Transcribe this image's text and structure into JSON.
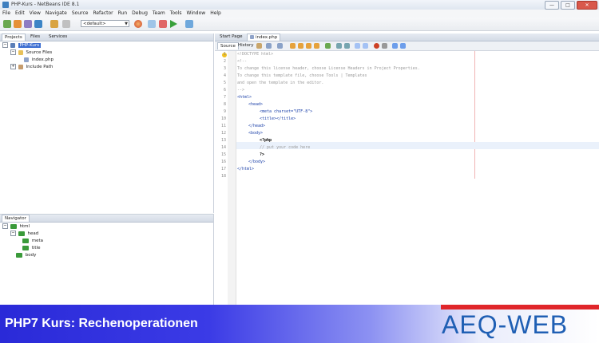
{
  "window": {
    "title": "PHP-Kurs - NetBeans IDE 8.1",
    "controls": [
      "—",
      "□",
      "✕"
    ]
  },
  "menu": [
    "File",
    "Edit",
    "View",
    "Navigate",
    "Source",
    "Refactor",
    "Run",
    "Debug",
    "Team",
    "Tools",
    "Window",
    "Help"
  ],
  "toolbar": {
    "config_value": "<default>",
    "icons": [
      "new-file-icon",
      "new-project-icon",
      "open-project-icon",
      "save-all-icon",
      "undo-icon",
      "redo-icon",
      "browser-icon",
      "clean-build-icon",
      "build-icon",
      "run-icon",
      "debug-icon"
    ]
  },
  "projects_panel": {
    "tabs": [
      "Projects",
      "Files",
      "Services"
    ],
    "tree": [
      {
        "label": "PHP-Kurs",
        "level": 0,
        "icon": "php-project-icon",
        "selected": true
      },
      {
        "label": "Source Files",
        "level": 1,
        "icon": "folder-icon"
      },
      {
        "label": "index.php",
        "level": 2,
        "icon": "php-file-icon"
      },
      {
        "label": "Include Path",
        "level": 1,
        "icon": "library-icon"
      }
    ]
  },
  "navigator_panel": {
    "title": "Navigator",
    "tree": [
      {
        "label": "html",
        "level": 0
      },
      {
        "label": "head",
        "level": 1
      },
      {
        "label": "meta",
        "level": 2
      },
      {
        "label": "title",
        "level": 2
      },
      {
        "label": "body",
        "level": 1
      }
    ]
  },
  "editor": {
    "tabs": [
      "Start Page",
      "index.php"
    ],
    "active_tab": "index.php",
    "mode_tabs": [
      "Source",
      "History"
    ],
    "active_mode": "Source",
    "lines": [
      {
        "n": "1",
        "text": "<!DOCTYPE html>",
        "indent": 0,
        "kind": "doctype"
      },
      {
        "n": "2",
        "text": "<!--",
        "indent": 0,
        "kind": "comment"
      },
      {
        "n": "3",
        "text": "To change this license header, choose License Headers in Project Properties.",
        "indent": 0,
        "kind": "comment"
      },
      {
        "n": "4",
        "text": "To change this template file, choose Tools | Templates",
        "indent": 0,
        "kind": "comment"
      },
      {
        "n": "5",
        "text": "and open the template in the editor.",
        "indent": 0,
        "kind": "comment"
      },
      {
        "n": "6",
        "text": "-->",
        "indent": 0,
        "kind": "comment"
      },
      {
        "n": "7",
        "text": "<html>",
        "indent": 0,
        "kind": "tag"
      },
      {
        "n": "8",
        "text": "<head>",
        "indent": 1,
        "kind": "tag"
      },
      {
        "n": "9",
        "text": "<meta charset=\"UTF-8\">",
        "indent": 2,
        "kind": "tag"
      },
      {
        "n": "10",
        "text": "<title></title>",
        "indent": 2,
        "kind": "tag"
      },
      {
        "n": "11",
        "text": "</head>",
        "indent": 1,
        "kind": "tag"
      },
      {
        "n": "12",
        "text": "<body>",
        "indent": 1,
        "kind": "tag"
      },
      {
        "n": "13",
        "text": "<?php",
        "indent": 2,
        "kind": "php"
      },
      {
        "n": "14",
        "text": "// put your code here",
        "indent": 2,
        "kind": "phpcomment"
      },
      {
        "n": "15",
        "text": "?>",
        "indent": 2,
        "kind": "php"
      },
      {
        "n": "16",
        "text": "</body>",
        "indent": 1,
        "kind": "tag"
      },
      {
        "n": "17",
        "text": "</html>",
        "indent": 0,
        "kind": "tag"
      },
      {
        "n": "18",
        "text": "",
        "indent": 0,
        "kind": "plain"
      }
    ]
  },
  "banner": {
    "title": "PHP7 Kurs: Rechenoperationen",
    "logo": "AEQ-WEB"
  },
  "colors": {
    "tag": "#1a3fa8",
    "comment": "#9a9a9a",
    "php": "#000000",
    "banner_blue": "#2a2ad8",
    "logo_red": "#e0262a",
    "logo_blue": "#1f5fb4"
  }
}
